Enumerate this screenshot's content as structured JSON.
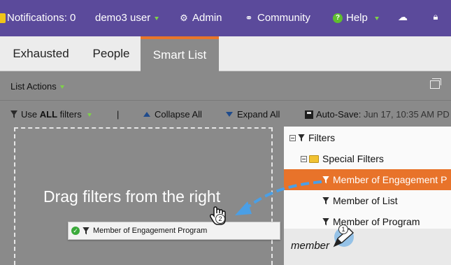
{
  "topbar": {
    "notifications": "Notifications: 0",
    "user": "demo3 user",
    "admin": "Admin",
    "community": "Community",
    "help": "Help"
  },
  "tabs": [
    {
      "label": "Exhausted"
    },
    {
      "label": "People"
    },
    {
      "label": "Smart List"
    }
  ],
  "list_actions": "List Actions",
  "toolbar": {
    "use_prefix": "Use",
    "use_bold": "ALL",
    "use_suffix": "filters",
    "separator": "|",
    "collapse": "Collapse All",
    "expand": "Expand All",
    "autosave": "Auto-Save:",
    "autosave_time": "Jun 17, 10:35 AM PD"
  },
  "droparea": {
    "text": "Drag filters from the right",
    "chip": "Member of Engagement Program"
  },
  "tree": {
    "root": "Filters",
    "group": "Special Filters",
    "items": [
      "Member of Engagement P",
      "Member of List",
      "Member of Program"
    ]
  },
  "search": {
    "value": "member"
  },
  "callouts": {
    "one": "1",
    "two": "2"
  },
  "colors": {
    "topbar": "#5b4a9b",
    "accent": "#e8732a",
    "panel": "#8a8a8a"
  }
}
